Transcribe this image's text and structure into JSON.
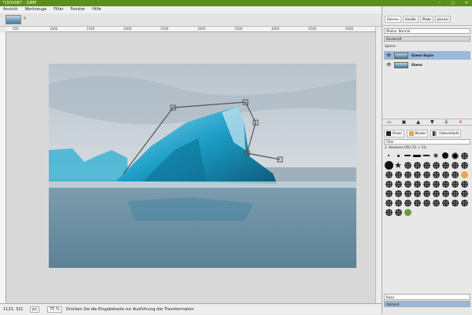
{
  "window": {
    "title": "*150X087 – GIMP",
    "controls": [
      "–",
      "□",
      "✕"
    ]
  },
  "menu": [
    "Ansicht",
    "Werkzeuge",
    "Filter",
    "Fenster",
    "Hilfe"
  ],
  "ruler": {
    "h_labels": [
      "500",
      "1000",
      "1500",
      "2000",
      "2500",
      "3000",
      "3500",
      "4000",
      "4500",
      "5000"
    ]
  },
  "status": {
    "coords": "1123, 321",
    "unit": "px",
    "zoom": "75 %",
    "message": "Drücken Sie die Eingabetaste zur Ausführung der Transformation"
  },
  "panel": {
    "tabs": [
      "Ebenen",
      "Kanäle",
      "Pfade",
      "Journal"
    ],
    "mode_label": "Modus: Normal",
    "opacity_label": "Deckkraft",
    "lock_label": "Sperre:",
    "layers": [
      {
        "name": "Ebene Kopie",
        "selected": true
      },
      {
        "name": "Ebene",
        "selected": false
      }
    ],
    "brush_tabs": [
      "Pinsel",
      "Muster",
      "Farbverläufe"
    ],
    "filter_label": "Filter",
    "brush_info": "2. Hardness 050 (51 × 51)",
    "basic_label": "Basis",
    "spacing_label": "Abstand"
  },
  "colors": {
    "titlebar": "#5a8f1e",
    "selection": "#9bb8d8"
  }
}
